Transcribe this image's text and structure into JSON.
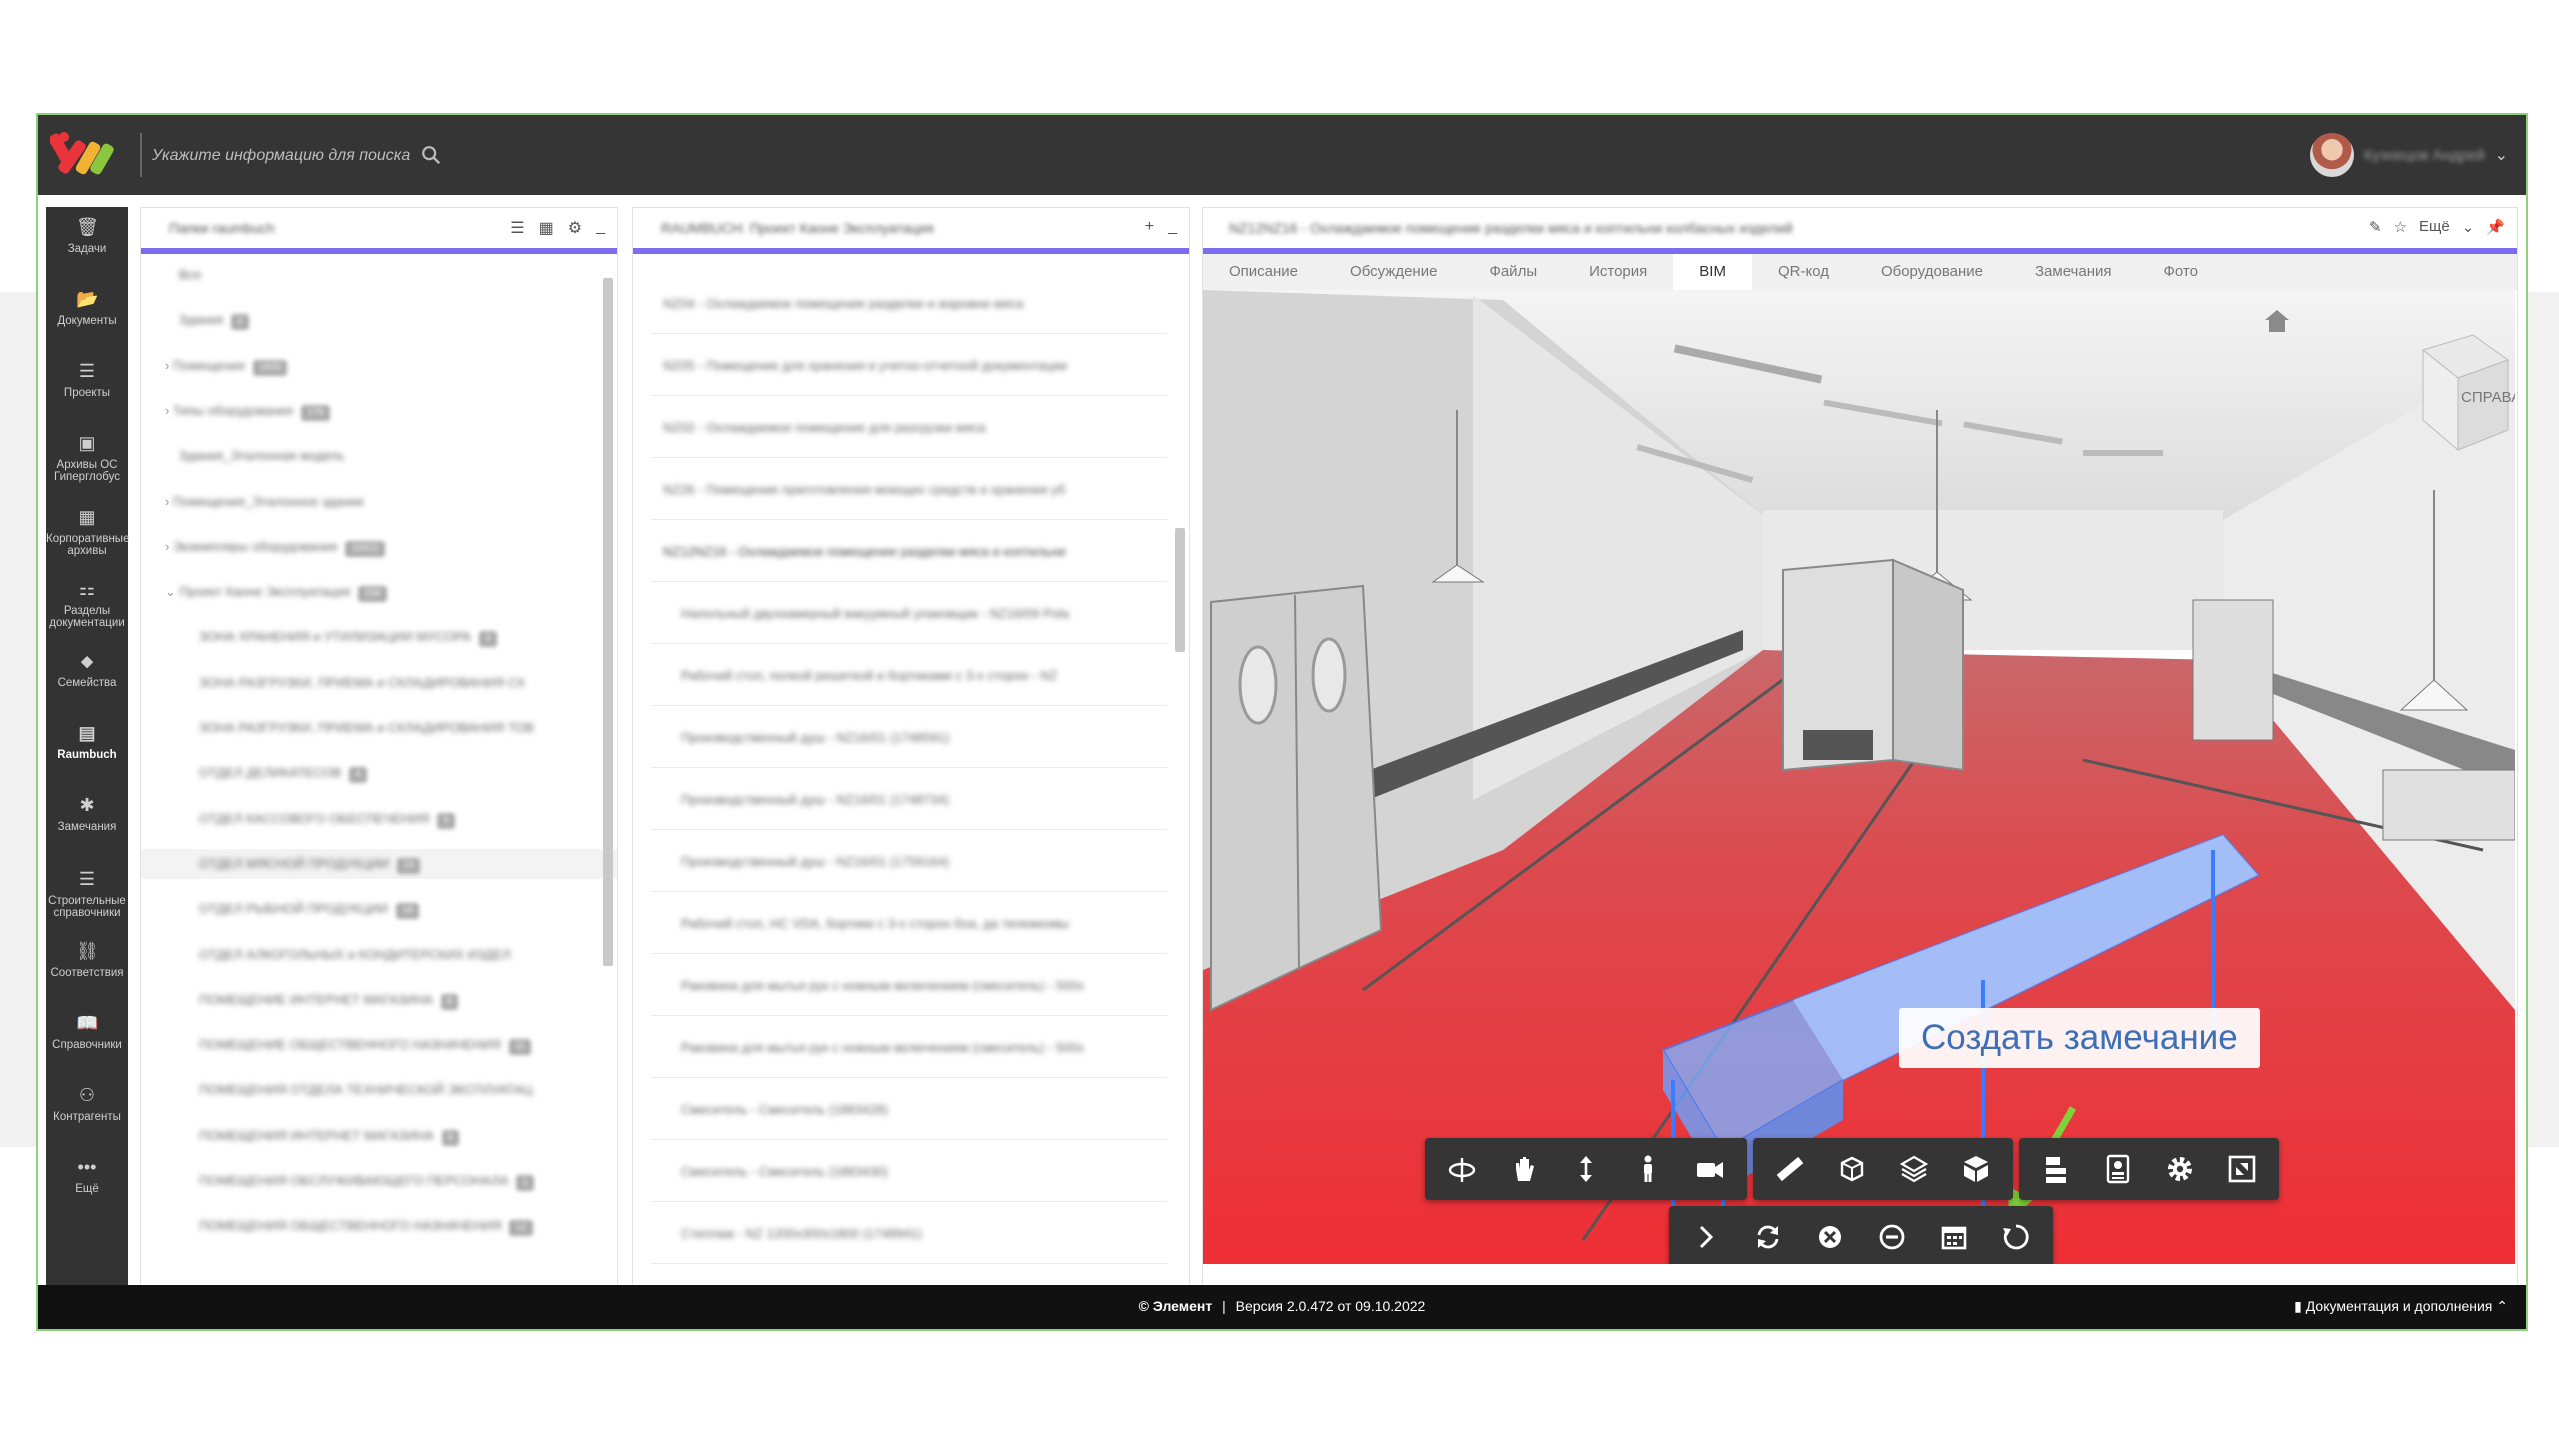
{
  "search": {
    "placeholder": "Укажите информацию для поиска"
  },
  "user": {
    "name": "Кузнецов Андрей"
  },
  "nav": {
    "items": [
      {
        "label": "Задачи",
        "icon": "trash-icon"
      },
      {
        "label": "Документы",
        "icon": "folder-icon"
      },
      {
        "label": "Проекты",
        "icon": "list-icon"
      },
      {
        "label": "Архивы ОС Гиперглобус",
        "icon": "archive-icon"
      },
      {
        "label": "Корпоративные архивы",
        "icon": "grid-icon"
      },
      {
        "label": "Разделы документации",
        "icon": "sections-icon"
      },
      {
        "label": "Семейства",
        "icon": "tag-icon"
      },
      {
        "label": "Raumbuch",
        "icon": "book-icon"
      },
      {
        "label": "Замечания",
        "icon": "bug-icon"
      },
      {
        "label": "Строительные справочники",
        "icon": "list-icon"
      },
      {
        "label": "Соответствия",
        "icon": "link-icon"
      },
      {
        "label": "Справочники",
        "icon": "open-book-icon"
      },
      {
        "label": "Контрагенты",
        "icon": "person-icon"
      },
      {
        "label": "Ещё",
        "icon": "more-icon"
      }
    ]
  },
  "folders": {
    "title": "Папки raumbuch",
    "items": [
      {
        "label": "Все",
        "badge": ""
      },
      {
        "label": "Здания",
        "badge": "2"
      },
      {
        "label": "Помещения",
        "badge": "1920"
      },
      {
        "label": "Типы оборудования",
        "badge": "178"
      },
      {
        "label": "Здания_Эталонная модель",
        "badge": ""
      },
      {
        "label": "Помещения_Эталонное здание",
        "badge": ""
      },
      {
        "label": "Экземпляры оборудования",
        "badge": "15922"
      },
      {
        "label": "Проект Каоне Эксплуатация",
        "badge": "258"
      },
      {
        "label": "ЗОНА ХРАНЕНИЯ и УТИЛИЗАЦИИ МУСОРА",
        "badge": "3"
      },
      {
        "label": "ЗОНА РАЗГРУЗКИ, ПРИЕМА и СКЛАДИРОВАНИЯ СХ",
        "badge": ""
      },
      {
        "label": "ЗОНА РАЗГРУЗКИ, ПРИЕМА и СКЛАДИРОВАНИЯ ТОВ",
        "badge": ""
      },
      {
        "label": "ОТДЕЛ ДЕЛИКАТЕСОВ",
        "badge": "4"
      },
      {
        "label": "ОТДЕЛ КАССОВОГО ОБЕСПЕЧЕНИЯ",
        "badge": "5"
      },
      {
        "label": "ОТДЕЛ МЯСНОЙ ПРОДУКЦИИ",
        "badge": "19"
      },
      {
        "label": "ОТДЕЛ РЫБНОЙ ПРОДУКЦИИ",
        "badge": "18"
      },
      {
        "label": "ОТДЕЛ АЛКОГОЛЬНЫХ и КОНДИТЕРСКИХ ИЗДЕЛ",
        "badge": ""
      },
      {
        "label": "ПОМЕЩЕНИЕ ИНТЕРНЕТ МАГАЗИНА",
        "badge": "8"
      },
      {
        "label": "ПОМЕЩЕНИЕ ОБЩЕСТВЕННОГО НАЗНАЧЕНИЯ",
        "badge": "11"
      },
      {
        "label": "ПОМЕЩЕНИЯ ОТДЕЛА ТЕХНИЧЕСКОЙ ЭКСПЛУАТАЦ",
        "badge": ""
      },
      {
        "label": "ПОМЕЩЕНИЯ ИНТЕРНЕТ МАГАЗИНА",
        "badge": "6"
      },
      {
        "label": "ПОМЕЩЕНИЯ ОБСЛУЖИВАЮЩЕГО ПЕРСОНАЛА",
        "badge": "1"
      },
      {
        "label": "ПОМЕЩЕНИЯ ОБЩЕСТВЕННОГО НАЗНАЧЕНИЯ",
        "badge": "12"
      }
    ]
  },
  "list": {
    "title": "RAUMBUCH: Проект Каоне Эксплуатация",
    "items": [
      "NZ04 - Охлаждаемое помещение разделки и жаровни мяса",
      "NZ05 - Помещение для хранения и учетно-отчетной документации",
      "NZ02 - Охлаждаемое помещение для разгрузки мяса",
      "NZ26 - Помещение приготовления моющих средств и хранения уб",
      "NZ12NZ16 - Охлаждаемое помещение разделки мяса и коптильни",
      "Напольный двухкамерный вакуумный упаковщик - NZ16/09 Pola",
      "Рабочий стол, полкой решеткой и бортиками с 3-х сторон - NZ",
      "Производственный душ - NZ16/01 (1748591)",
      "Производственный душ - NZ16/01 (1748734)",
      "Производственный душ - NZ16/01 (1759164)",
      "Рабочий стол, НС VDA, бортики с 3-х сторон боа, да тележкомы",
      "Раковина для мытья рук с ножным включением (смеситель) - 500х",
      "Раковина для мытья рук с ножным включением (смеситель) - 500х",
      "Смеситель - Смеситель (1883428)",
      "Смеситель - Смеситель (1883430)",
      "Стеллаж - NZ 1200х300х1800 (1748941)"
    ]
  },
  "detail": {
    "title": "NZ12NZ16 - Охлаждаемое помещение разделки мяса и коптильни колбасных изделий",
    "more_label": "Ещё",
    "tabs": [
      "Описание",
      "Обсуждение",
      "Файлы",
      "История",
      "BIM",
      "QR-код",
      "Оборудование",
      "Замечания",
      "Фото"
    ],
    "active_tab": "BIM",
    "cube_label": "СПРАВА",
    "tooltip": "Создать замечание",
    "colors": {
      "accent": "#7b6cf0",
      "floor": "#e8343a",
      "selection": "#6aa2ff",
      "arrow": "#7fd23a"
    }
  },
  "footer": {
    "copyright": "© Элемент",
    "separator": "|",
    "version": "Версия 2.0.472 от 09.10.2022",
    "docs_label": "Документация и дополнения"
  }
}
